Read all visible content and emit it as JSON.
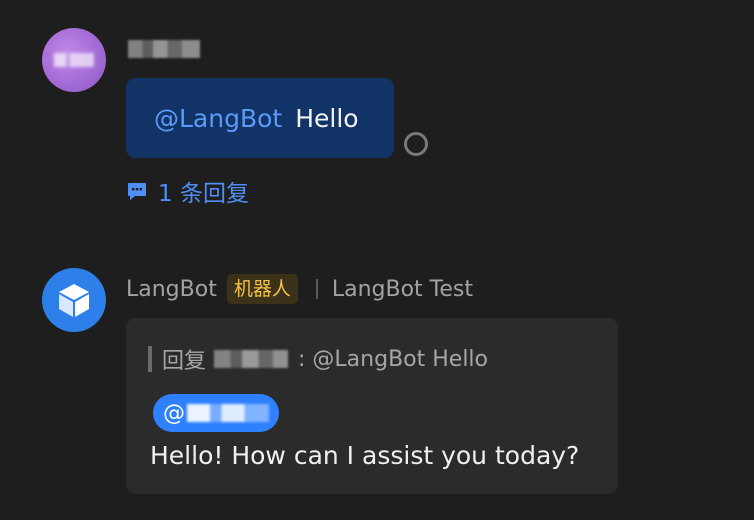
{
  "messages": [
    {
      "sender_avatar": "user-avatar",
      "mention": "@LangBot",
      "text": "Hello",
      "reply_count_label": "1 条回复"
    },
    {
      "sender_name": "LangBot",
      "bot_badge": "机器人",
      "channel": "LangBot Test",
      "quote_prefix": "回复",
      "quote_suffix": ":  @LangBot Hello",
      "mention_prefix": "@",
      "text": "Hello! How can I assist you today?"
    }
  ],
  "icons": {
    "status": "circle-outline-icon",
    "reply": "chat-bubble-icon",
    "bot_avatar": "cube-icon"
  },
  "colors": {
    "background": "#1e1e1f",
    "accent": "#4f8ef5",
    "bubble_self": "#113366",
    "bubble_other": "#2b2b2c",
    "badge_text": "#f2c24b"
  }
}
